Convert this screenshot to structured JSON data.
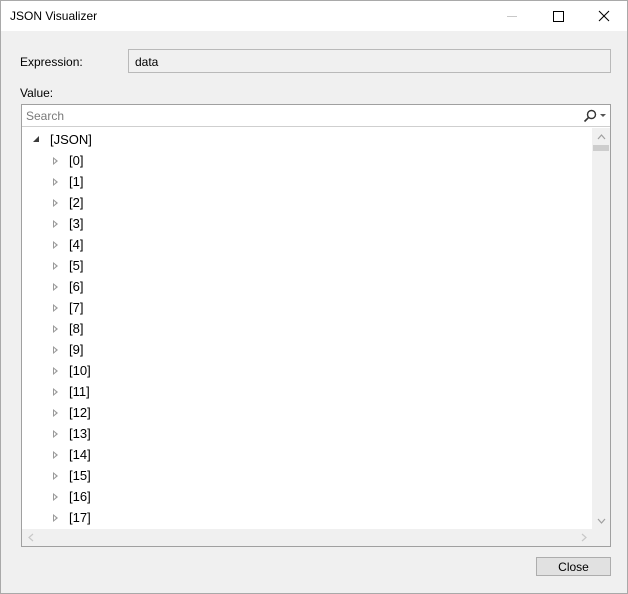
{
  "window": {
    "title": "JSON Visualizer"
  },
  "expression": {
    "label": "Expression:",
    "value": "data"
  },
  "value": {
    "label": "Value:"
  },
  "search": {
    "placeholder": "Search"
  },
  "tree": {
    "root": {
      "label": "[JSON]",
      "expanded": true
    },
    "items": [
      {
        "label": "[0]"
      },
      {
        "label": "[1]"
      },
      {
        "label": "[2]"
      },
      {
        "label": "[3]"
      },
      {
        "label": "[4]"
      },
      {
        "label": "[5]"
      },
      {
        "label": "[6]"
      },
      {
        "label": "[7]"
      },
      {
        "label": "[8]"
      },
      {
        "label": "[9]"
      },
      {
        "label": "[10]"
      },
      {
        "label": "[11]"
      },
      {
        "label": "[12]"
      },
      {
        "label": "[13]"
      },
      {
        "label": "[14]"
      },
      {
        "label": "[15]"
      },
      {
        "label": "[16]"
      },
      {
        "label": "[17]"
      }
    ]
  },
  "buttons": {
    "close_label": "Close"
  },
  "icons": {
    "search": "search-icon",
    "minimize": "minimize-icon",
    "maximize": "maximize-icon",
    "close": "close-icon"
  }
}
